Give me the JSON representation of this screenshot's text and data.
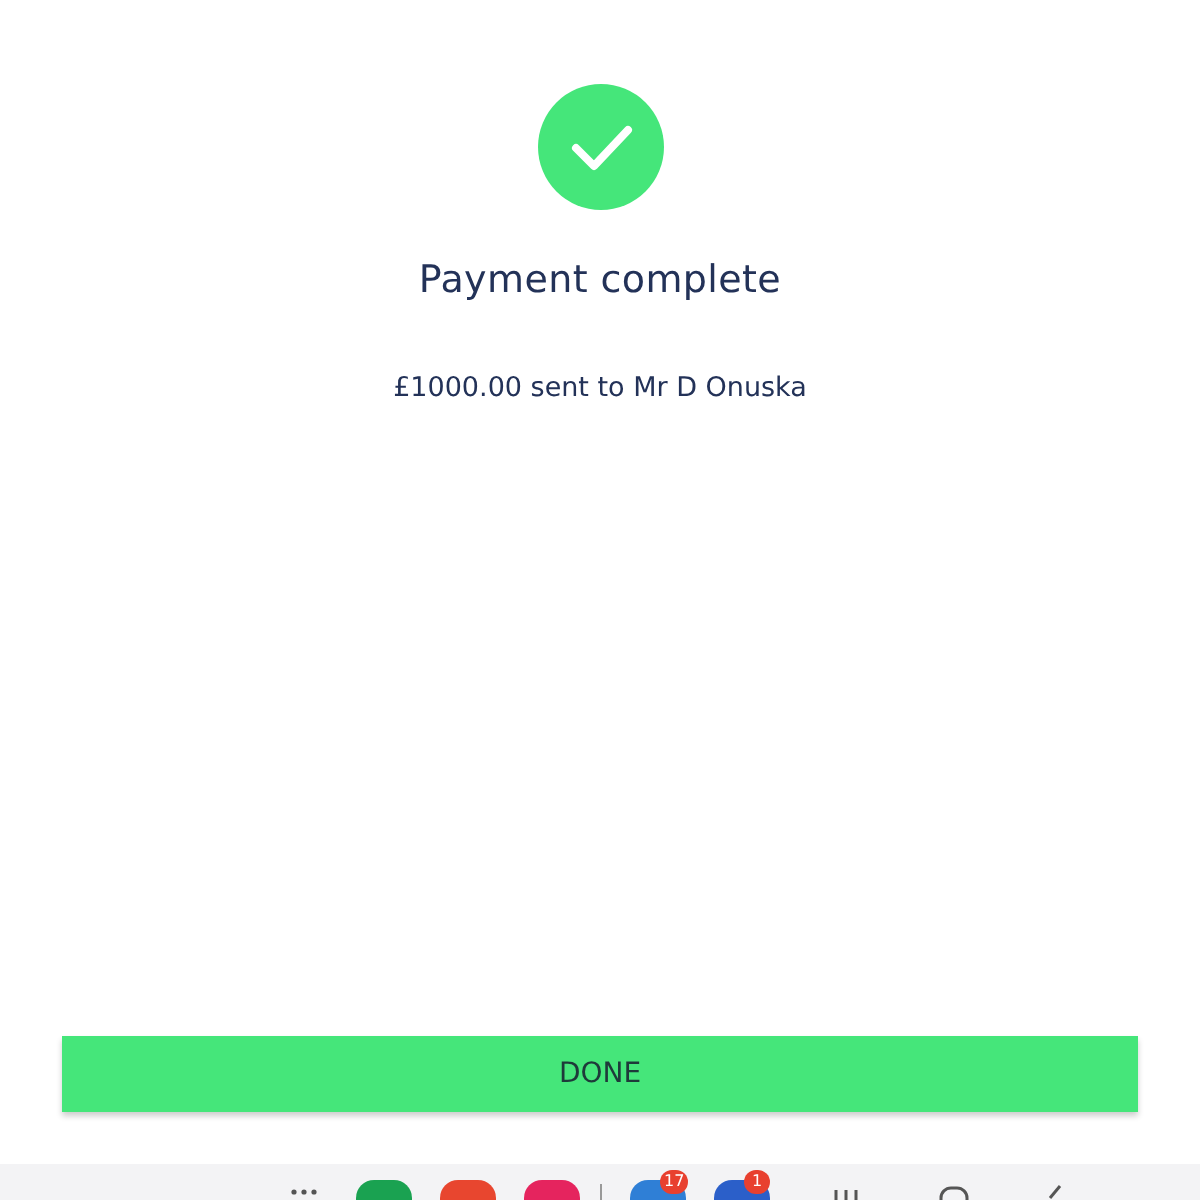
{
  "status": {
    "kind": "success"
  },
  "title": "Payment complete",
  "message": "£1000.00 sent to Mr D Onuska",
  "button": "DONE",
  "taskbar": [
    {
      "kind": "grid"
    },
    {
      "kind": "app",
      "color": "#1aa251"
    },
    {
      "kind": "app",
      "color": "#e8462f"
    },
    {
      "kind": "app",
      "color": "#e5245e"
    },
    {
      "kind": "divider"
    },
    {
      "kind": "app",
      "color": "#2f7fd6",
      "badge": "17"
    },
    {
      "kind": "app",
      "color": "#2b5fc9",
      "badge": "1"
    },
    {
      "kind": "recents"
    },
    {
      "kind": "home"
    },
    {
      "kind": "back"
    }
  ]
}
